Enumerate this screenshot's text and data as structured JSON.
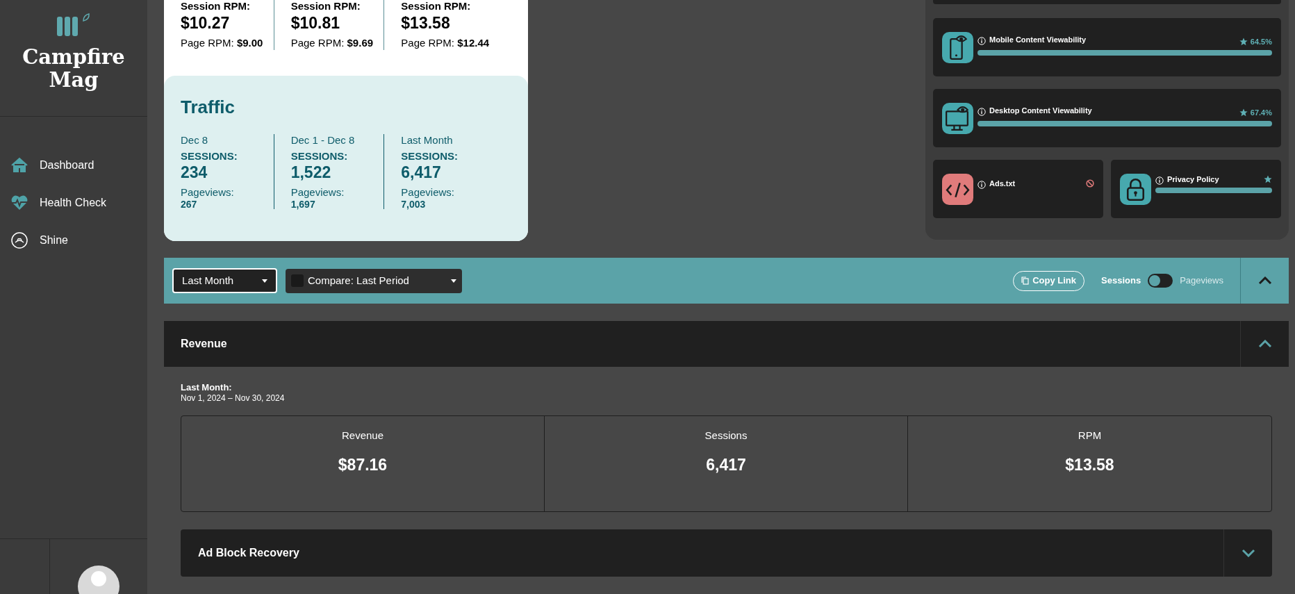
{
  "sidebar": {
    "brand": "Campfire Mag",
    "nav": [
      {
        "label": "Dashboard"
      },
      {
        "label": "Health Check"
      },
      {
        "label": "Shine"
      }
    ]
  },
  "rpm": [
    {
      "label": "Session RPM:",
      "value": "$10.27",
      "page": "Page RPM: **$9.00**"
    },
    {
      "label": "Session RPM:",
      "value": "$10.81",
      "page": "Page RPM: **$9.69**"
    },
    {
      "label": "Session RPM:",
      "value": "$13.58",
      "page": "Page RPM: **$12.44**"
    }
  ],
  "traffic": {
    "title": "Traffic",
    "columns": [
      {
        "period": "Dec 8",
        "sessions_label": "SESSIONS:",
        "sessions": "234",
        "pageviews_label": "Pageviews:",
        "pageviews": "267"
      },
      {
        "period": "Dec 1 - Dec 8",
        "sessions_label": "SESSIONS:",
        "sessions": "1,522",
        "pageviews_label": "Pageviews:",
        "pageviews": "1,697"
      },
      {
        "period": "Last Month",
        "sessions_label": "SESSIONS:",
        "sessions": "6,417",
        "pageviews_label": "Pageviews:",
        "pageviews": "7,003"
      }
    ]
  },
  "health": [
    {
      "kind": "wide",
      "title": "Mobile Content Viewability",
      "passed": true,
      "score": "64.5%"
    },
    {
      "kind": "wide",
      "title": "Desktop Content Viewability",
      "passed": true,
      "score": "67.4%"
    },
    {
      "kind": "half",
      "title": "Ads.txt",
      "passed": false
    },
    {
      "kind": "half",
      "title": "Privacy Policy",
      "passed": true
    }
  ],
  "filters": {
    "range": "Last Month",
    "compare": {
      "checked": false,
      "label": "Compare: Last Period"
    },
    "copy_link": "Copy Link",
    "toggle_on": false,
    "metric_toggle": [
      {
        "label": "Sessions",
        "selected": true
      },
      {
        "label": "Pageviews",
        "selected": false
      }
    ],
    "expanded": true
  },
  "revenue": {
    "title": "Revenue",
    "expanded": true,
    "period_label": "Last Month:",
    "date_range": "Nov 1, 2024 – Nov 30, 2024",
    "metrics": [
      {
        "label": "Revenue",
        "value": "$87.16"
      },
      {
        "label": "Sessions",
        "value": "6,417"
      },
      {
        "label": "RPM",
        "value": "$13.58"
      }
    ],
    "subsections": [
      {
        "title": "Ad Block Recovery",
        "expanded": false
      }
    ]
  }
}
